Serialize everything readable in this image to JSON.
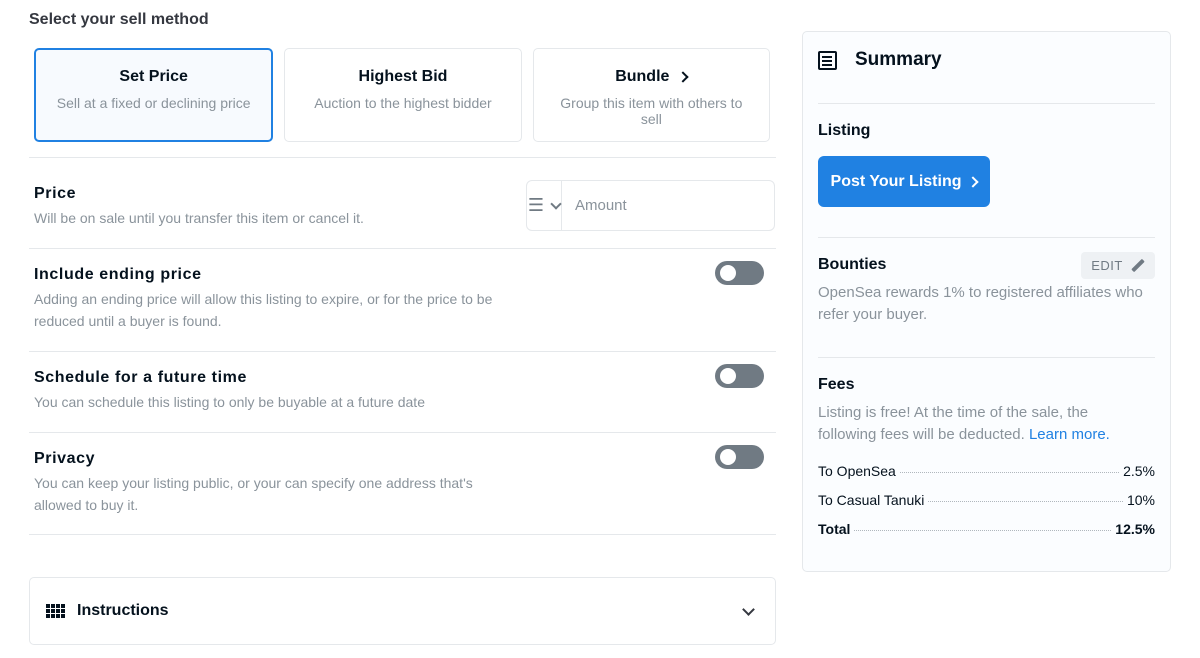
{
  "sell_method": {
    "heading": "Select your sell method",
    "options": [
      {
        "title": "Set Price",
        "desc": "Sell at a fixed or declining price",
        "selected": true
      },
      {
        "title": "Highest Bid",
        "desc": "Auction to the highest bidder",
        "selected": false
      },
      {
        "title": "Bundle",
        "desc": "Group this item with others to sell",
        "selected": false
      }
    ]
  },
  "price": {
    "title": "Price",
    "desc": "Will be on sale until you transfer this item or cancel it.",
    "amount_placeholder": "Amount"
  },
  "ending_price": {
    "title": "Include ending price",
    "desc": "Adding an ending price will allow this listing to expire, or for the price to be reduced until a buyer is found.",
    "enabled": false
  },
  "schedule": {
    "title": "Schedule for a future time",
    "desc": "You can schedule this listing to only be buyable at a future date",
    "enabled": false
  },
  "privacy": {
    "title": "Privacy",
    "desc": "You can keep your listing public, or your can specify one address that's allowed to buy it.",
    "enabled": false
  },
  "instructions": {
    "label": "Instructions"
  },
  "summary": {
    "title": "Summary",
    "listing_label": "Listing",
    "post_button": "Post Your Listing",
    "bounties_label": "Bounties",
    "edit_button": "EDIT",
    "bounties_text": "OpenSea rewards 1% to registered affiliates who refer your buyer.",
    "fees_label": "Fees",
    "fees_text": "Listing is free! At the time of the sale, the following fees will be deducted.",
    "learn_more": "Learn more.",
    "fees": [
      {
        "label": "To OpenSea",
        "value": "2.5%"
      },
      {
        "label": "To Casual Tanuki",
        "value": "10%"
      }
    ],
    "total": {
      "label": "Total",
      "value": "12.5%"
    }
  },
  "colors": {
    "accent": "#2081e2",
    "toggle_off": "#707a83",
    "muted_text": "#8a939b",
    "border": "#e5e8eb"
  }
}
